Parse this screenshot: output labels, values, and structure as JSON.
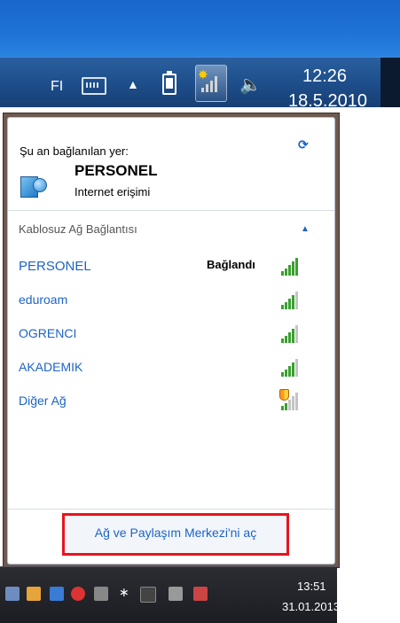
{
  "top_taskbar": {
    "language": "FI",
    "up_arrow": "▲",
    "speaker_glyph": "🔊",
    "time": "12:26",
    "date": "18.5.2010"
  },
  "popup": {
    "connected_to_label": "Şu an bağlanılan yer:",
    "current_network": {
      "name": "PERSONEL",
      "status": "Internet erişimi"
    },
    "section_title": "Kablosuz Ağ Bağlantısı",
    "networks": [
      {
        "name": "PERSONEL",
        "status": "Bağlandı",
        "signal": 5,
        "secured_warning": false
      },
      {
        "name": "eduroam",
        "status": "",
        "signal": 4,
        "secured_warning": false
      },
      {
        "name": "OGRENCI",
        "status": "",
        "signal": 4,
        "secured_warning": false
      },
      {
        "name": "AKADEMIK",
        "status": "",
        "signal": 4,
        "secured_warning": false
      },
      {
        "name": "Diğer Ağ",
        "status": "",
        "signal": 2,
        "secured_warning": true
      }
    ],
    "footer_link": "Ağ ve Paylaşım Merkezi'ni aç",
    "colors": {
      "link": "#1c63c8",
      "highlight_border": "#e8141c"
    }
  },
  "bottom_taskbar": {
    "time": "13:51",
    "date": "31.01.2013"
  }
}
